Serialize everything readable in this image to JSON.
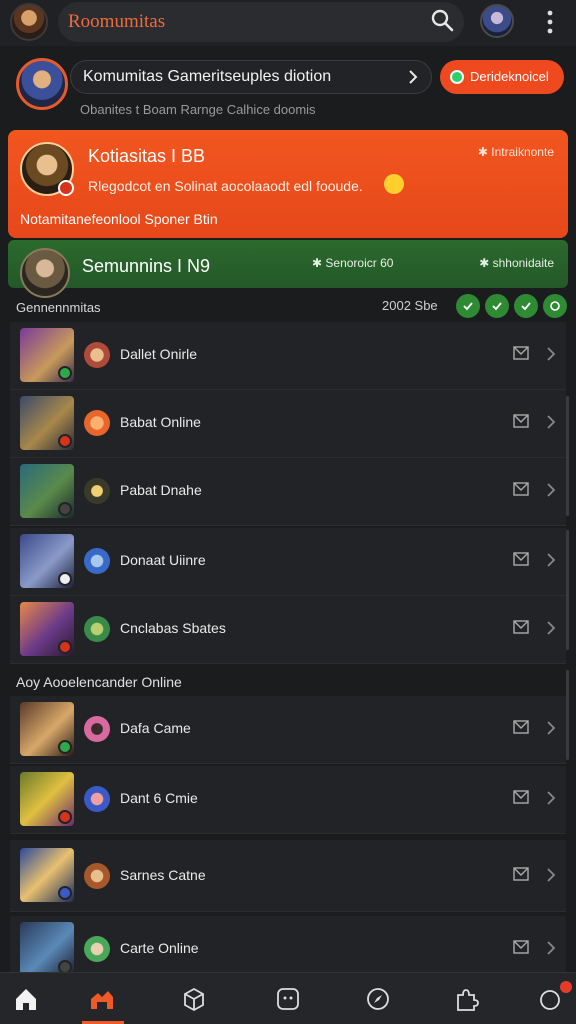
{
  "topbar": {
    "title": "Roomumitas",
    "icons": [
      "avatar",
      "search-icon",
      "user-avatar",
      "more-vertical-icon"
    ]
  },
  "header": {
    "pill_text": "Komumitas Gameritseuples diotion",
    "button_label": "Derideknoicel",
    "subtitle": "Obanites t Boam Rarnge  Calhice doomis"
  },
  "featured": {
    "title": "Kotiasitas I BB",
    "meta": "✱ Intraiknonte",
    "description": "Rlegodcot en Solinat aocolaaodt edl fooude.",
    "footer": "Notamitanefeonlool Sponer Btin"
  },
  "banner": {
    "title": "Semunnins I N9",
    "meta_left": "✱ Senoroicr 60",
    "meta_right": "✱ shhonidaite"
  },
  "section": {
    "label": "Gennennmitas",
    "count": "2002 Sbe"
  },
  "rows": [
    {
      "label": "Dallet Onirle",
      "thumb": "#7a3a9a",
      "badge": "#2fa84a",
      "icon": "#b04a3a"
    },
    {
      "label": "Babat Online",
      "thumb": "#3a4a6a",
      "badge": "#d6341a",
      "icon": "#e8662a"
    },
    {
      "label": "Pabat Dnahe",
      "thumb": "#2a6a7a",
      "badge": "#444",
      "icon": "#c8a23a"
    },
    {
      "label": "Donaat Uiinre",
      "thumb": "#3a4a8a",
      "badge": "#eee",
      "icon": "#3a6ac8"
    },
    {
      "label": "Cnclabas Sbates",
      "thumb": "#8a3a3a",
      "badge": "#d6341a",
      "icon": "#3a8a4a"
    }
  ],
  "mid_label": "Aoy Aooelencander Online",
  "rows2": [
    {
      "label": "Dafa Came",
      "thumb": "#5a3a2a",
      "badge": "#2fa84a",
      "icon": "#d86aa0"
    },
    {
      "label": "Dant 6 Cmie",
      "thumb": "#6a7a2a",
      "badge": "#d6341a",
      "icon": "#3a5ac8"
    },
    {
      "label": "Sarnes Catne",
      "thumb": "#2a4a9a",
      "badge": "#3a5ac8",
      "icon": "#a8582a"
    },
    {
      "label": "Carte Online",
      "thumb": "#2a3a5a",
      "badge": "#444",
      "icon": "#4aa85a"
    }
  ],
  "nav": [
    "home-icon",
    "community-icon",
    "box-icon",
    "chat-icon",
    "compass-icon",
    "puzzle-icon",
    "notification-icon"
  ]
}
